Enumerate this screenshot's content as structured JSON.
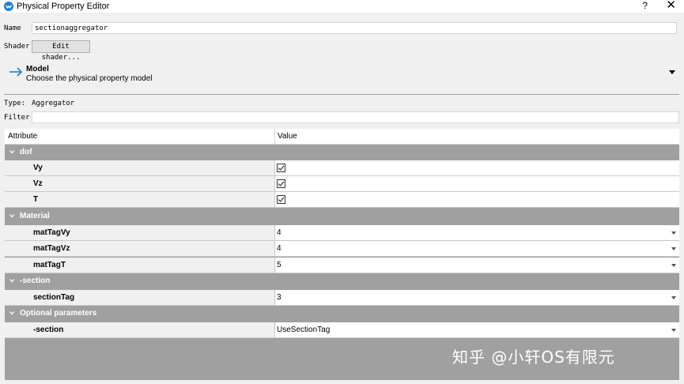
{
  "window": {
    "title": "Physical Property Editor",
    "help": "?",
    "close": "✕"
  },
  "name_row": {
    "label": "Name",
    "value": "sectionaggregator"
  },
  "shader_row": {
    "label": "Shader",
    "button": "Edit shader..."
  },
  "model": {
    "title": "Model",
    "subtitle": "Choose the physical property model"
  },
  "type_row": {
    "label": "Type:",
    "value": "Aggregator"
  },
  "filter_row": {
    "label": "Filter",
    "value": ""
  },
  "table": {
    "headers": [
      "Attribute",
      "Value"
    ],
    "groups": [
      {
        "label": "dof",
        "rows": [
          {
            "name": "Vy",
            "value": "",
            "checked": true
          },
          {
            "name": "Vz",
            "value": "",
            "checked": true
          },
          {
            "name": "T",
            "value": "",
            "checked": true
          }
        ]
      },
      {
        "label": "Material",
        "rows": [
          {
            "name": "matTagVy",
            "value": "4"
          },
          {
            "name": "matTagVz",
            "value": "4"
          },
          {
            "name": "matTagT",
            "value": "5"
          }
        ]
      },
      {
        "label": "-section",
        "rows": [
          {
            "name": "sectionTag",
            "value": "3"
          }
        ]
      },
      {
        "label": "Optional parameters",
        "rows": [
          {
            "name": "-section",
            "value": "UseSectionTag"
          }
        ]
      }
    ]
  },
  "watermark": "知乎 @小轩OS有限元",
  "colors": {
    "accent": "#1e7fd6",
    "group_bg": "#a0a0a0",
    "window_bg": "#f0f0f0"
  }
}
